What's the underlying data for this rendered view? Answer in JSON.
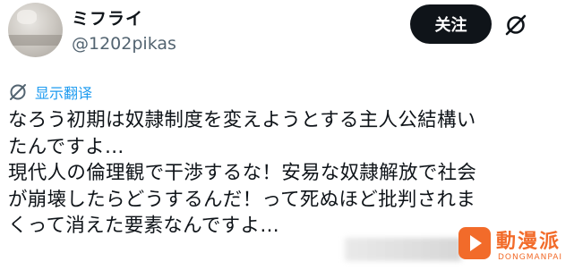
{
  "author": {
    "display_name": "ミフライ",
    "handle": "@1202pikas"
  },
  "header": {
    "follow_label": "关注",
    "grok_icon": "grok-icon"
  },
  "translate": {
    "label": "显示翻译",
    "icon": "globe-icon"
  },
  "post": {
    "lines": [
      "なろう初期は奴隷制度を変えようとする主人公結構い",
      "たんですよ…",
      "現代人の倫理観で干渉するな！安易な奴隷解放で社会",
      "が崩壊したらどうするんだ！って死ぬほど批判されま",
      "くって消えた要素なんですよ…"
    ]
  },
  "watermark": {
    "name": "動漫派",
    "sub": "DONGMANPAI",
    "color": "#f26b2a"
  }
}
